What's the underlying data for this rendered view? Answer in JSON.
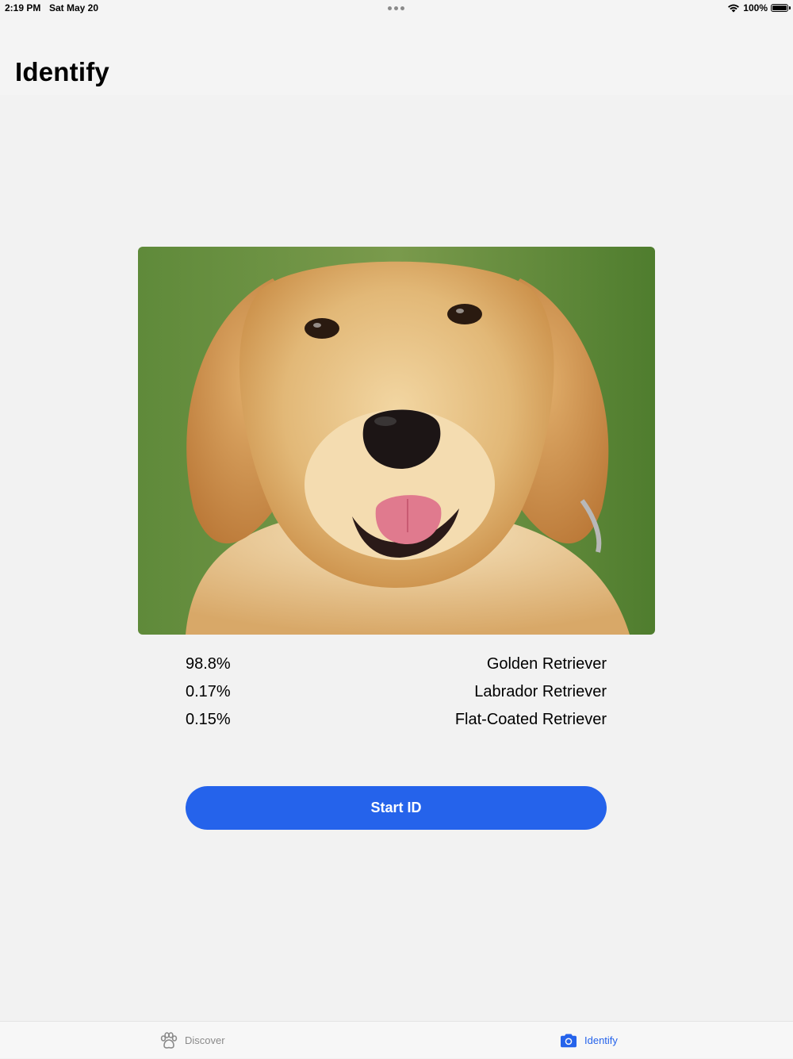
{
  "status_bar": {
    "time": "2:19 PM",
    "date": "Sat May 20",
    "battery": "100%"
  },
  "nav": {
    "title": "Identify"
  },
  "photo": {
    "icon": "dog-photo"
  },
  "results": [
    {
      "percent": "98.8%",
      "breed": "Golden Retriever"
    },
    {
      "percent": "0.17%",
      "breed": "Labrador Retriever"
    },
    {
      "percent": "0.15%",
      "breed": "Flat-Coated Retriever"
    }
  ],
  "action": {
    "start_label": "Start ID"
  },
  "tab_bar": {
    "tabs": [
      {
        "label": "Discover",
        "icon": "paw-icon",
        "selected": false
      },
      {
        "label": "Identify",
        "icon": "camera-icon",
        "selected": true
      }
    ]
  },
  "colors": {
    "accent": "#2563eb",
    "inactive": "#8a8a8a",
    "background": "#f2f2f2"
  }
}
